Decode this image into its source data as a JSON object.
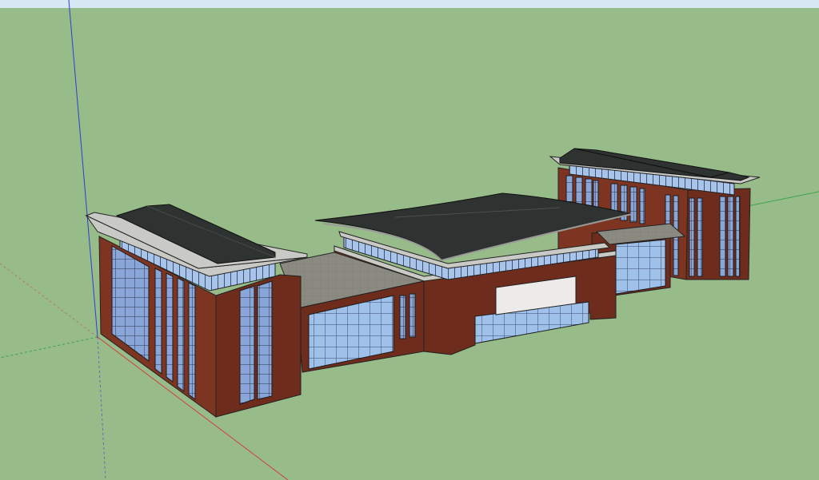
{
  "viewport": {
    "sky_color": "#d7e7f4",
    "ground_color": "#97bb89"
  },
  "axes": {
    "x_axis_color": "#d0403a",
    "y_axis_color": "#3fa34a",
    "z_axis_color": "#2b3fd6"
  },
  "model": {
    "brick_color": "#6e2c1d",
    "brick_light": "#7d3522",
    "roof_color": "#2e3331",
    "slab_color": "#c9c9c5",
    "glass_color": "#8aa6d8",
    "glass_light": "#b8cfee",
    "flat_roof_color": "#8b8a80",
    "sign_panel_color": "#ecebe9"
  }
}
